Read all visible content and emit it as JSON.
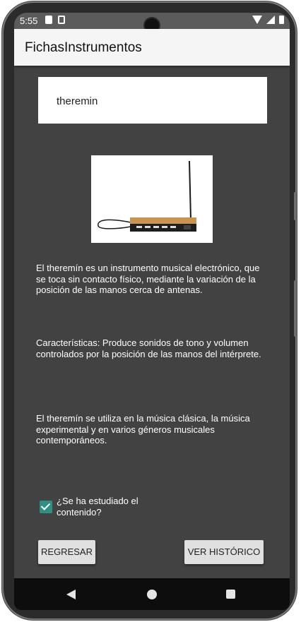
{
  "status_bar": {
    "time": "5:55",
    "left_icons": [
      "sd-card-icon",
      "sim-icon"
    ],
    "right_icons": [
      "wifi-icon",
      "signal-icon",
      "battery-icon"
    ]
  },
  "app_bar": {
    "title": "FichasInstrumentos"
  },
  "instrument": {
    "name": "theremin",
    "image_description_icon": "theremin-image",
    "description": "El theremín es un instrumento musical electrónico, que se toca sin contacto físico, mediante la variación de la posición de las manos cerca de antenas.",
    "characteristics": "Características: Produce sonidos de tono y volumen controlados por la posición de las manos del intérprete.",
    "usage": "El theremín se utiliza en la música clásica, la música experimental y en varios géneros musicales contemporáneos."
  },
  "studied": {
    "label": "¿Se ha estudiado el contenido?",
    "checked": true,
    "accent_color": "#2f8f82"
  },
  "buttons": {
    "back": "REGRESAR",
    "history": "VER HISTÓRICO"
  },
  "nav": {
    "back_icon": "back-triangle-icon",
    "home_icon": "home-circle-icon",
    "recents_icon": "recents-square-icon"
  },
  "colors": {
    "background": "#424242",
    "app_bar": "#f5f5f5",
    "button": "#e0e0e0"
  }
}
